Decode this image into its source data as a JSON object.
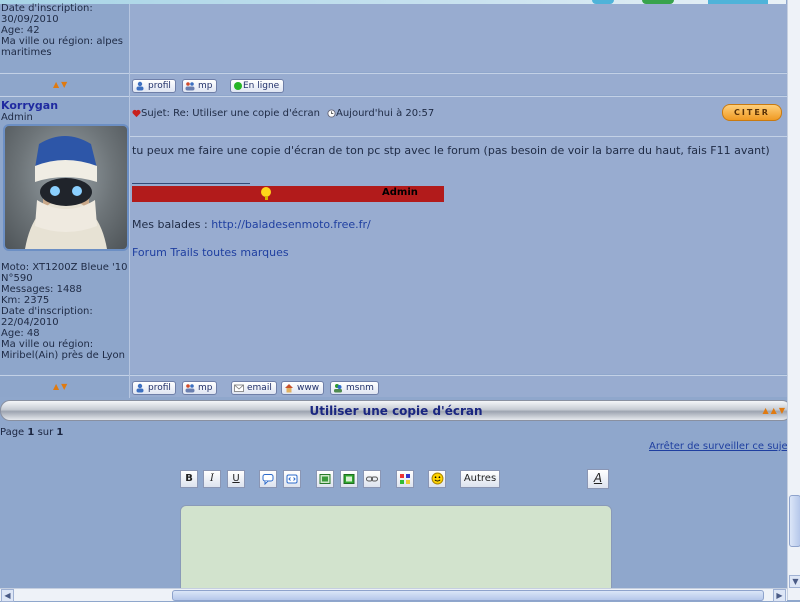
{
  "prev_post": {
    "profile_lines": [
      "Date d'inscription:",
      "30/09/2010",
      "Age: 42",
      "Ma ville ou région: alpes",
      "maritimes"
    ],
    "buttons": [
      "profil",
      "mp",
      "En ligne"
    ]
  },
  "post": {
    "username": "Korrygan",
    "rank": "Admin",
    "profile_lines": [
      "Moto: XT1200Z Bleue '10",
      "N°590",
      "Messages: 1488",
      "Km: 2375",
      "Date d'inscription:",
      "22/04/2010",
      "Age: 48",
      "Ma ville ou région:",
      "Miribel(Ain) près de Lyon"
    ],
    "subject": "Sujet: Re: Utiliser une copie d'écran",
    "time": "Aujourd'hui à 20:57",
    "quote_button": "CITER",
    "message": "tu peux me faire une copie d'écran de ton pc stp avec le forum (pas besoin de voir la barre du haut, fais F11 avant)",
    "signature_admin": "Admin",
    "signature_balades_label": "Mes balades :",
    "signature_balades_url": "http://baladesenmoto.free.fr/",
    "signature_forum_link": "Forum Trails toutes marques",
    "buttons": [
      "profil",
      "mp",
      "email",
      "www",
      "msnm"
    ]
  },
  "topic": {
    "title": "Utiliser une copie d'écran",
    "page_label": "Page",
    "page_current": "1",
    "page_sep": "sur",
    "page_total": "1",
    "stop_watch": "Arrêter de surveiller ce sujet"
  },
  "editor": {
    "bold": "B",
    "italic": "I",
    "underline": "U",
    "autres": "Autres",
    "fontsize": "A"
  }
}
